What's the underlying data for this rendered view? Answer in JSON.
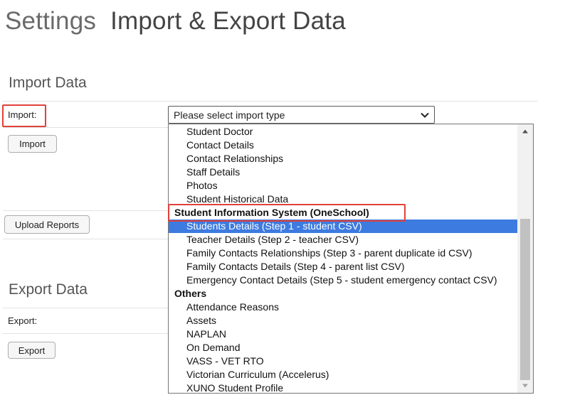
{
  "page": {
    "breadcrumb_root": "Settings",
    "title": "Import & Export Data"
  },
  "import_section": {
    "title": "Import Data",
    "label": "Import:",
    "select_value": "Please select import type",
    "import_button": "Import",
    "upload_reports_button": "Upload Reports"
  },
  "export_section": {
    "title": "Export Data",
    "label": "Export:",
    "export_button": "Export"
  },
  "dropdown": {
    "options": [
      {
        "label": "Student Doctor",
        "kind": "item"
      },
      {
        "label": "Contact Details",
        "kind": "item"
      },
      {
        "label": "Contact Relationships",
        "kind": "item"
      },
      {
        "label": "Staff Details",
        "kind": "item"
      },
      {
        "label": "Photos",
        "kind": "item"
      },
      {
        "label": "Student Historical Data",
        "kind": "item"
      },
      {
        "label": "Student Information System (OneSchool)",
        "kind": "group"
      },
      {
        "label": "Students Details (Step 1 - student CSV)",
        "kind": "item",
        "selected": true
      },
      {
        "label": "Teacher Details (Step 2 - teacher CSV)",
        "kind": "item"
      },
      {
        "label": "Family Contacts Relationships (Step 3 - parent duplicate id CSV)",
        "kind": "item"
      },
      {
        "label": "Family Contacts Details (Step 4 - parent list CSV)",
        "kind": "item"
      },
      {
        "label": "Emergency Contact Details (Step 5 - student emergency contact CSV)",
        "kind": "item"
      },
      {
        "label": "Others",
        "kind": "group"
      },
      {
        "label": "Attendance Reasons",
        "kind": "item"
      },
      {
        "label": "Assets",
        "kind": "item"
      },
      {
        "label": "NAPLAN",
        "kind": "item"
      },
      {
        "label": "On Demand",
        "kind": "item"
      },
      {
        "label": "VASS - VET RTO",
        "kind": "item"
      },
      {
        "label": "Victorian Curriculum (Accelerus)",
        "kind": "item"
      },
      {
        "label": "XUNO Student Profile",
        "kind": "item"
      }
    ]
  },
  "colors": {
    "highlight_box": "#e0413a",
    "selected_option": "#3d7be0"
  }
}
